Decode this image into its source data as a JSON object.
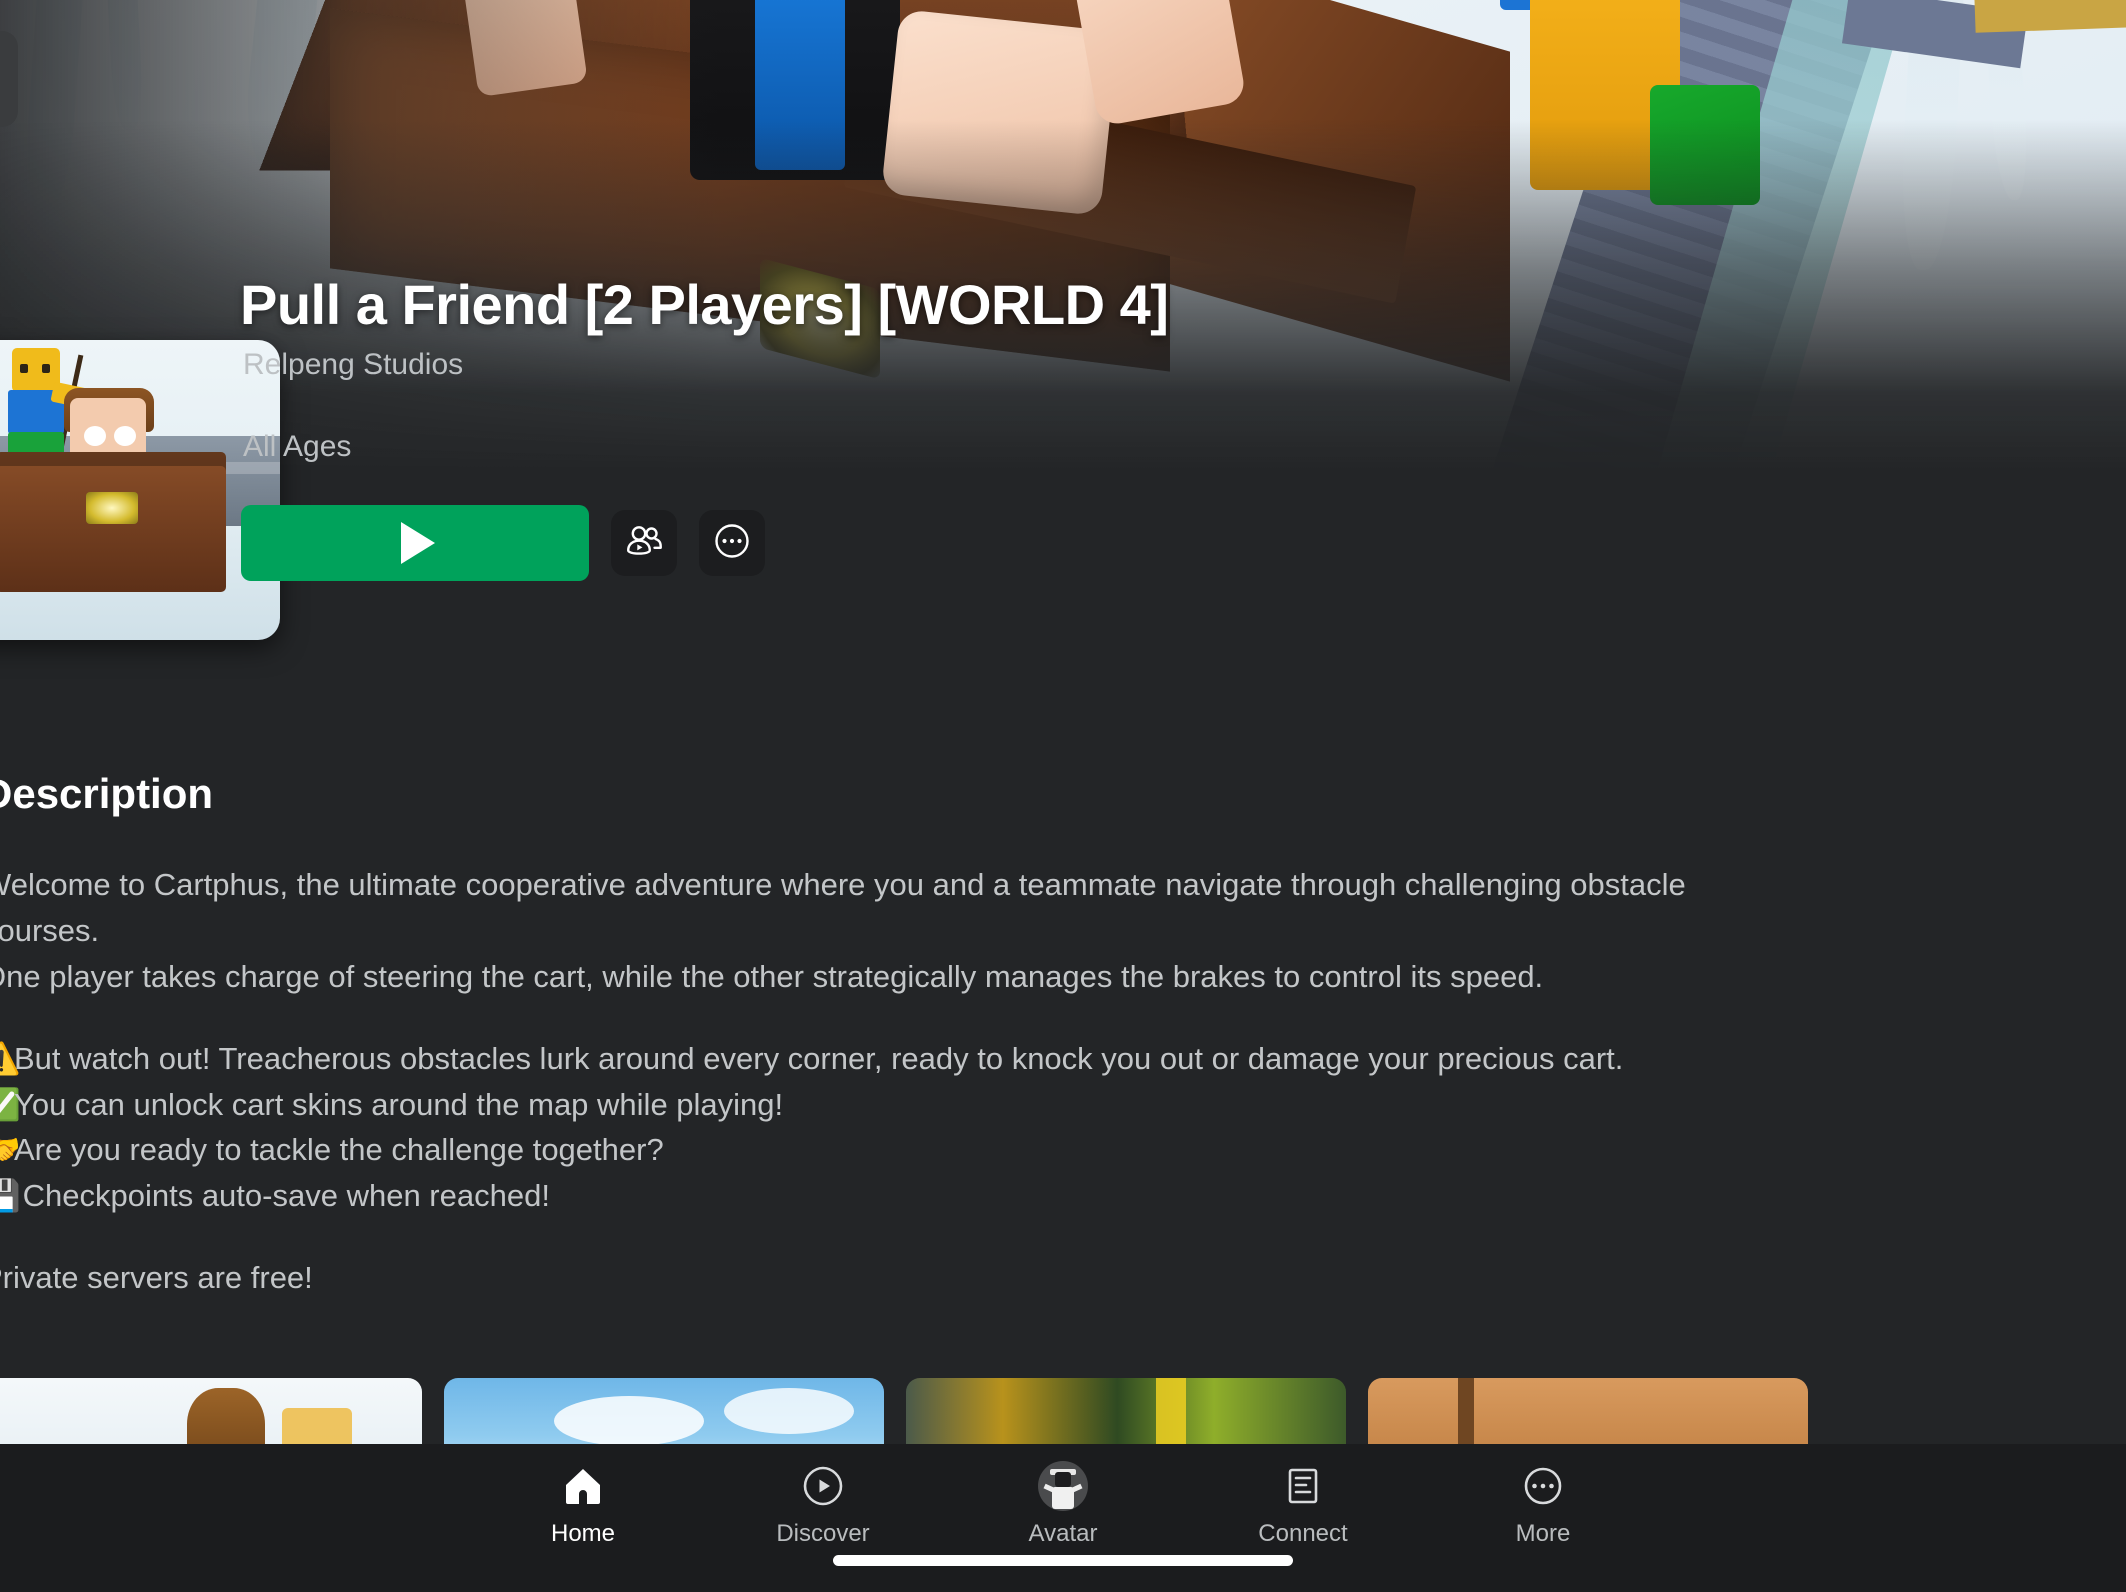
{
  "app": {
    "background_color": "#232527",
    "accent_green": "#00A25B",
    "nav_background": "#1B1C1E"
  },
  "hero": {
    "back_button_label": "Back",
    "banner_alt": "Roblox gameplay screenshot of a character in a wooden cart"
  },
  "game": {
    "title": "Pull a Friend [2 Players] [WORLD 4]",
    "creator": "Relpeng Studios",
    "age_rating": "All Ages",
    "icon_alt": "Game icon showing a screaming character riding a wooden cart"
  },
  "actions": {
    "play_label": "Play",
    "play_icon": "play-triangle-icon",
    "party_label": "Join Friends",
    "party_icon": "people-play-icon",
    "more_label": "More Options",
    "more_icon": "circle-ellipsis-icon"
  },
  "description": {
    "heading": "Description",
    "lines": [
      {
        "emoji": "",
        "text": "Welcome to Cartphus, the ultimate cooperative adventure where you and a teammate navigate through challenging obstacle"
      },
      {
        "emoji": "",
        "text": "courses."
      },
      {
        "emoji": "",
        "text": "One player takes charge of steering the cart, while the other strategically manages the brakes to control its speed."
      },
      {
        "emoji": "",
        "text": ""
      },
      {
        "emoji": "⚠️",
        "text": "But watch out! Treacherous obstacles lurk around every corner, ready to knock you out or damage your precious cart."
      },
      {
        "emoji": "✅",
        "text": "You can unlock cart skins around the map while playing!"
      },
      {
        "emoji": "🤝",
        "text": "Are you ready to tackle the challenge together?"
      },
      {
        "emoji": "💾",
        "text": " Checkpoints auto-save when reached!"
      },
      {
        "emoji": "",
        "text": ""
      },
      {
        "emoji": "",
        "text": "Private servers are free!"
      }
    ]
  },
  "thumbnails": [
    {
      "alt": "Gameplay thumbnail 1"
    },
    {
      "alt": "Gameplay thumbnail 2"
    },
    {
      "alt": "Gameplay thumbnail 3"
    },
    {
      "alt": "Gameplay thumbnail 4"
    }
  ],
  "bottom_nav": {
    "items": [
      {
        "label": "Home",
        "icon": "house-icon",
        "active": true
      },
      {
        "label": "Discover",
        "icon": "compass-play-icon",
        "active": false
      },
      {
        "label": "Avatar",
        "icon": "avatar-portrait-icon",
        "active": false
      },
      {
        "label": "Connect",
        "icon": "chat-document-icon",
        "active": false
      },
      {
        "label": "More",
        "icon": "circle-ellipsis-icon",
        "active": false
      }
    ]
  }
}
